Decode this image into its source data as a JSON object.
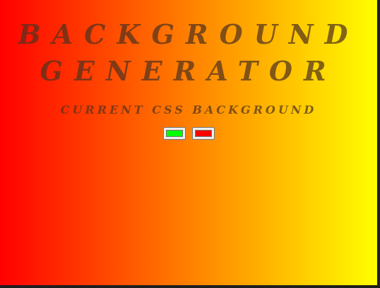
{
  "header": {
    "title_line1": "BACKGROUND",
    "title_line2": "GENERATOR",
    "subtitle": "CURRENT CSS BACKGROUND"
  },
  "colors": {
    "gradient_start": "#ff0000",
    "gradient_end": "#ffff00",
    "color1_value": "#00ff00",
    "color2_value": "#ff0000"
  },
  "controls": {
    "color1_icon": "color-picker",
    "color2_icon": "color-picker"
  }
}
